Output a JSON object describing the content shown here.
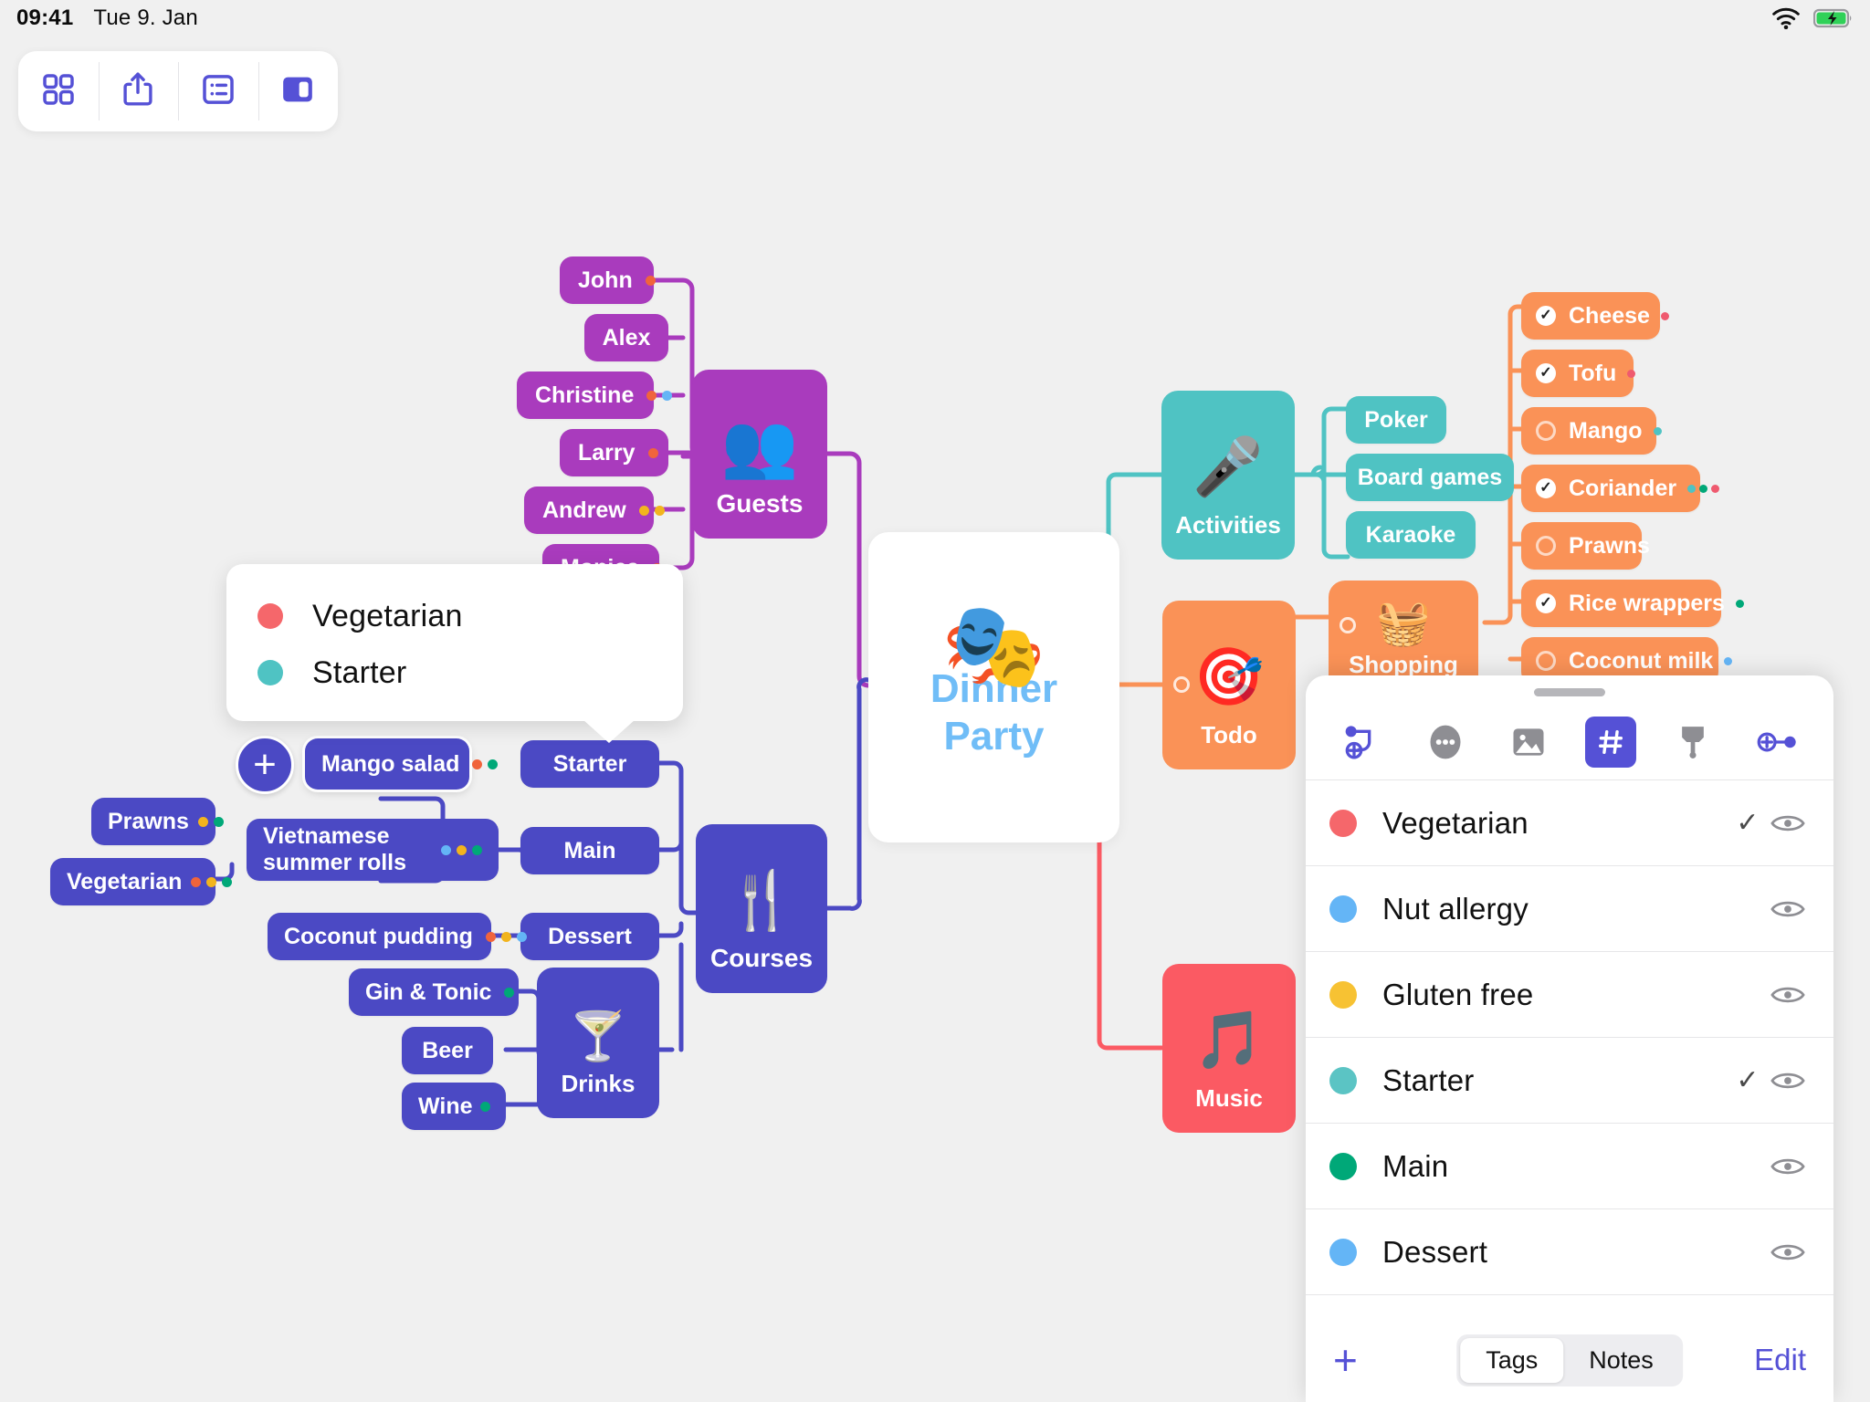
{
  "status_bar": {
    "time": "09:41",
    "date": "Tue 9. Jan",
    "wifi_icon": "wifi-icon",
    "battery_icon": "battery-charging-icon"
  },
  "toolbar": {
    "buttons": [
      {
        "name": "grid-view-button",
        "icon": "grid-icon"
      },
      {
        "name": "share-button",
        "icon": "share-up-arrow-icon"
      },
      {
        "name": "outline-view-button",
        "icon": "list-outline-icon"
      },
      {
        "name": "sidebar-toggle-button",
        "icon": "sidebar-panel-icon"
      }
    ]
  },
  "central_node": {
    "title_line1": "Dinner",
    "title_line2": "Party",
    "icon": "masquerade-mask-icon",
    "color": "#70bdf7"
  },
  "branches": {
    "guests": {
      "label": "Guests",
      "icon": "two-people-icon",
      "color": "#a93bbd",
      "children": [
        {
          "label": "John",
          "tags": [
            "#f0643c"
          ]
        },
        {
          "label": "Alex",
          "tags": []
        },
        {
          "label": "Christine",
          "tags": [
            "#f0643c",
            "#64b5f6"
          ]
        },
        {
          "label": "Larry",
          "tags": [
            "#f0643c"
          ]
        },
        {
          "label": "Andrew",
          "tags": [
            "#f2b41e",
            "#f2b41e"
          ]
        },
        {
          "label": "Monica",
          "tags": [
            "#f0643c"
          ]
        }
      ]
    },
    "courses": {
      "label": "Courses",
      "icon": "fork-knife-icon",
      "color": "#4b49c4",
      "children": [
        {
          "label": "Starter",
          "tags": []
        },
        {
          "label": "Main",
          "tags": []
        },
        {
          "label": "Dessert",
          "tags": []
        },
        {
          "label": "Drinks",
          "icon": "cocktail-icon",
          "tags": []
        }
      ],
      "leaves": [
        {
          "label": "Mango salad",
          "tags": [
            "#f0643c",
            "#00a878"
          ],
          "selected": true
        },
        {
          "label": "Vietnamese summer rolls",
          "tags": [
            "#64b5f6",
            "#f2b41e",
            "#00a878"
          ]
        },
        {
          "label": "Prawns",
          "tags": [
            "#f2b41e",
            "#00a878"
          ]
        },
        {
          "label": "Vegetarian",
          "tags": [
            "#f0643c",
            "#f2b41e",
            "#00a878"
          ]
        },
        {
          "label": "Coconut pudding",
          "tags": [
            "#f0643c",
            "#f2b41e",
            "#64b5f6"
          ]
        },
        {
          "label": "Gin & Tonic",
          "tags": [
            "#00a878"
          ]
        },
        {
          "label": "Beer",
          "tags": []
        },
        {
          "label": "Wine",
          "tags": [
            "#00a878"
          ]
        }
      ]
    },
    "activities": {
      "label": "Activities",
      "icon": "microphone-icon",
      "color": "#4fc3c3",
      "children": [
        {
          "label": "Poker"
        },
        {
          "label": "Board games"
        },
        {
          "label": "Karaoke"
        }
      ]
    },
    "todo": {
      "label": "Todo",
      "icon": "dartboard-icon",
      "color": "#fa9257"
    },
    "shopping": {
      "label": "Shopping",
      "icon": "shopping-basket-icon",
      "color": "#fa9257",
      "items": [
        {
          "label": "Cheese",
          "checked": true,
          "tags": [
            "#ef5a6f"
          ]
        },
        {
          "label": "Tofu",
          "checked": true,
          "tags": [
            "#ef5a6f"
          ]
        },
        {
          "label": "Mango",
          "checked": false,
          "tags": [
            "#4fc3c3"
          ]
        },
        {
          "label": "Coriander",
          "checked": true,
          "tags": [
            "#4fc3c3",
            "#00a878",
            "#ef5a6f"
          ]
        },
        {
          "label": "Prawns",
          "checked": false,
          "tags": []
        },
        {
          "label": "Rice wrappers",
          "checked": true,
          "tags": [
            "#00a878"
          ]
        },
        {
          "label": "Coconut milk",
          "checked": false,
          "tags": [
            "#64b5f6"
          ]
        }
      ]
    },
    "music": {
      "label": "Music",
      "icon": "music-note-icon",
      "color": "#fb5a63"
    }
  },
  "tooltip": {
    "tags": [
      {
        "label": "Vegetarian",
        "color": "#f5676b"
      },
      {
        "label": "Starter",
        "color": "#4fc3c3"
      }
    ]
  },
  "inspector_panel": {
    "tools": [
      {
        "name": "add-relation-icon",
        "active": false
      },
      {
        "name": "more-options-icon",
        "active": false
      },
      {
        "name": "image-icon",
        "active": false
      },
      {
        "name": "tag-hash-icon",
        "active": true
      },
      {
        "name": "paintbrush-icon",
        "active": false
      },
      {
        "name": "add-node-icon",
        "active": false
      }
    ],
    "tags": [
      {
        "label": "Vegetarian",
        "color": "#f5676b",
        "checked": true,
        "eye_icon": "eye-icon"
      },
      {
        "label": "Nut allergy",
        "color": "#64b5f6",
        "checked": false,
        "eye_icon": "eye-icon"
      },
      {
        "label": "Gluten free",
        "color": "#f7c233",
        "checked": false,
        "eye_icon": "eye-icon"
      },
      {
        "label": "Starter",
        "color": "#5bc4c4",
        "checked": true,
        "eye_icon": "eye-icon"
      },
      {
        "label": "Main",
        "color": "#00a878",
        "checked": false,
        "eye_icon": "eye-icon"
      },
      {
        "label": "Dessert",
        "color": "#64b5f6",
        "checked": false,
        "eye_icon": "eye-icon"
      }
    ],
    "footer": {
      "add_label": "+",
      "segments": [
        {
          "label": "Tags",
          "selected": true
        },
        {
          "label": "Notes",
          "selected": false
        }
      ],
      "edit_label": "Edit"
    }
  },
  "checkmark_glyph": "✓",
  "add_node_glyph": "+"
}
